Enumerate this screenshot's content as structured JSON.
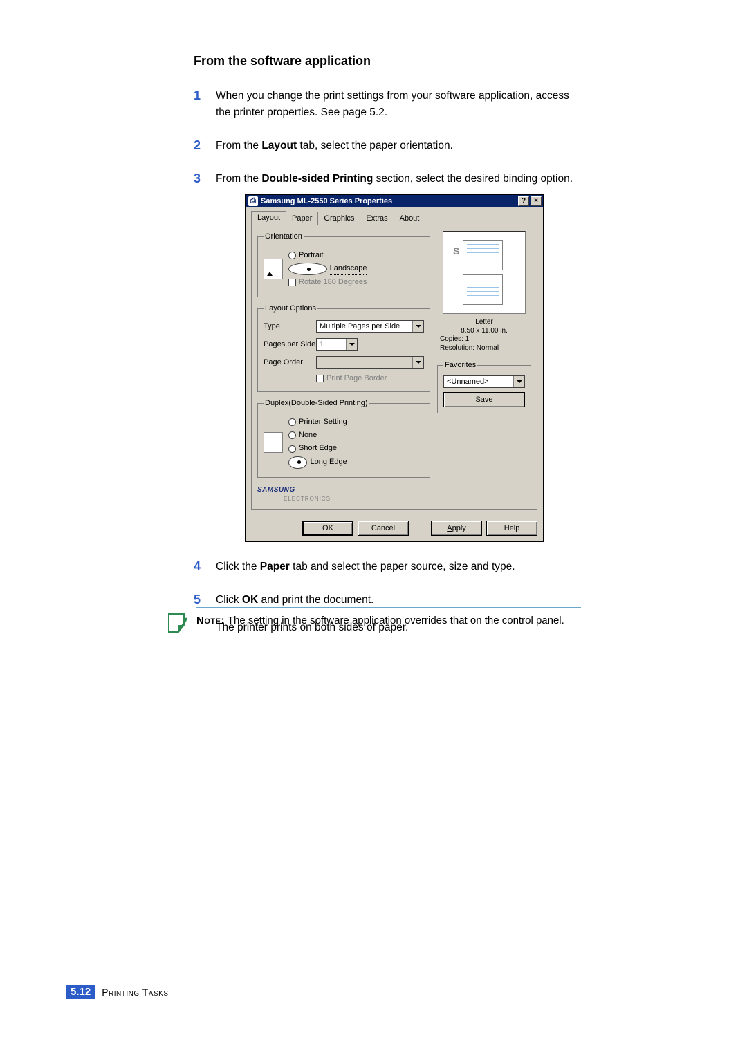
{
  "section": {
    "title": "From the software application"
  },
  "steps": {
    "s1": "When you change the print settings from your software application, access the printer properties. See page 5.2.",
    "s2_pre": "From the ",
    "s2_b": "Layout",
    "s2_post": " tab, select the paper orientation.",
    "s3_pre": "From the ",
    "s3_b": "Double-sided Printing",
    "s3_post": " section, select the desired binding option.",
    "s4_pre": "Click the ",
    "s4_b": "Paper",
    "s4_post": " tab and select the paper source, size and type.",
    "s5_pre": "Click ",
    "s5_b": "OK",
    "s5_post": " and print the document.",
    "after": "The printer prints on both sides of paper."
  },
  "dialog": {
    "title": "Samsung ML-2550 Series Properties",
    "tabs": [
      "Layout",
      "Paper",
      "Graphics",
      "Extras",
      "About"
    ],
    "orientation": {
      "legend": "Orientation",
      "portrait": "Portrait",
      "landscape": "Landscape",
      "selected": "landscape",
      "rotate": "Rotate 180 Degrees"
    },
    "layout_options": {
      "legend": "Layout Options",
      "type_label": "Type",
      "type_value": "Multiple Pages per Side",
      "pps_label": "Pages per Side",
      "pps_value": "1",
      "order_label": "Page Order",
      "order_value": "",
      "border": "Print Page Border"
    },
    "duplex": {
      "legend": "Duplex(Double-Sided Printing)",
      "printer_setting": "Printer Setting",
      "none": "None",
      "short": "Short Edge",
      "long": "Long Edge",
      "selected": "long"
    },
    "preview": {
      "paper": "Letter",
      "size": "8.50 x 11.00 in.",
      "copies": "Copies: 1",
      "resolution": "Resolution: Normal"
    },
    "favorites": {
      "legend": "Favorites",
      "value": "<Unnamed>",
      "save": "Save"
    },
    "brand": {
      "name": "SAMSUNG",
      "sub": "ELECTRONICS"
    },
    "buttons": {
      "ok": "OK",
      "cancel": "Cancel",
      "apply": "Apply",
      "help": "Help"
    }
  },
  "note": {
    "label": "Note:",
    "text": " The setting in the software application overrides that on the control panel."
  },
  "footer": {
    "chapter": "5.",
    "page": "12",
    "label": "Printing Tasks"
  }
}
